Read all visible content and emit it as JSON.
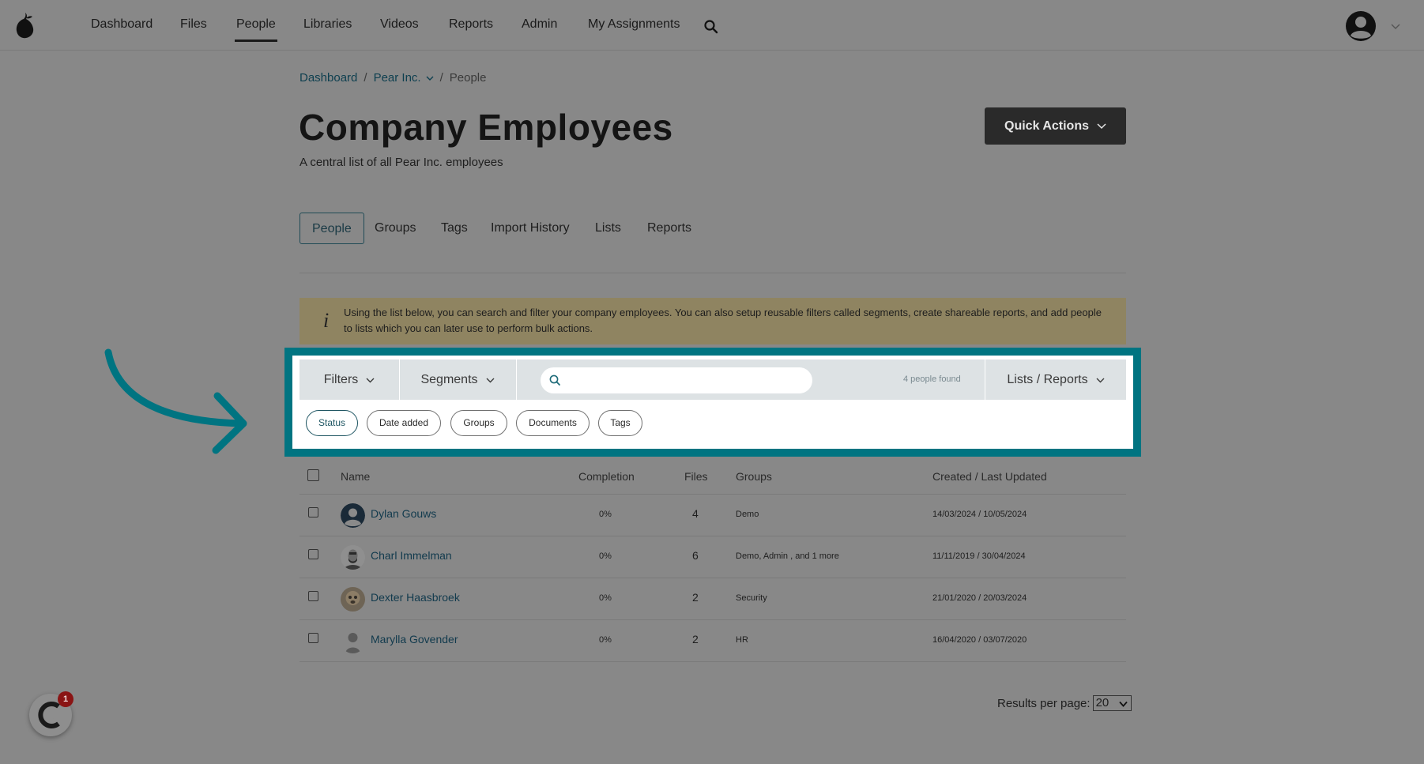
{
  "nav": {
    "items": [
      {
        "label": "Dashboard"
      },
      {
        "label": "Files"
      },
      {
        "label": "People",
        "active": true
      },
      {
        "label": "Libraries"
      },
      {
        "label": "Videos"
      },
      {
        "label": "Reports"
      },
      {
        "label": "Admin"
      },
      {
        "label": "My Assignments"
      }
    ],
    "logo_icon": "pear-logo-icon",
    "search_icon": "search-icon",
    "account_icon": "user-avatar-icon"
  },
  "breadcrumb": {
    "home": "Dashboard",
    "company": "Pear Inc.",
    "separator": "/",
    "current": "People"
  },
  "header": {
    "title": "Company Employees",
    "subtitle": "A central list of all Pear Inc. employees",
    "quick_actions_label": "Quick Actions"
  },
  "tabs": [
    {
      "label": "People",
      "active": true
    },
    {
      "label": "Groups"
    },
    {
      "label": "Tags"
    },
    {
      "label": "Import History"
    },
    {
      "label": "Lists"
    },
    {
      "label": "Reports"
    }
  ],
  "info": {
    "icon": "i",
    "text": "Using the list below, you can search and filter your company employees. You can also setup reusable filters called segments, create shareable reports, and add people to lists which you can later use to perform bulk actions."
  },
  "filterbar": {
    "filters_label": "Filters",
    "segments_label": "Segments",
    "search_value": "",
    "count_text": "4 people found",
    "lists_reports_label": "Lists / Reports",
    "chips": [
      {
        "label": "Status",
        "active": true
      },
      {
        "label": "Date added"
      },
      {
        "label": "Groups"
      },
      {
        "label": "Documents"
      },
      {
        "label": "Tags"
      }
    ]
  },
  "table": {
    "columns": {
      "name": "Name",
      "completion": "Completion",
      "files": "Files",
      "groups": "Groups",
      "dates": "Created / Last Updated"
    },
    "rows": [
      {
        "name": "Dylan Gouws",
        "completion": "0%",
        "files": "4",
        "groups": "Demo",
        "dates": "14/03/2024 / 10/05/2024"
      },
      {
        "name": "Charl Immelman",
        "completion": "0%",
        "files": "6",
        "groups": "Demo, Admin , and 1 more",
        "dates": "11/11/2019 / 30/04/2024"
      },
      {
        "name": "Dexter Haasbroek",
        "completion": "0%",
        "files": "2",
        "groups": "Security",
        "dates": "21/01/2020 / 20/03/2024"
      },
      {
        "name": "Marylla Govender",
        "completion": "0%",
        "files": "2",
        "groups": "HR",
        "dates": "16/04/2020 / 03/07/2020"
      }
    ]
  },
  "pagination": {
    "results_label": "Results per page:",
    "per_page": "20"
  },
  "chat": {
    "badge_count": "1"
  },
  "colors": {
    "highlight": "#007481",
    "overlay": "#888888",
    "link": "#113a4d"
  }
}
